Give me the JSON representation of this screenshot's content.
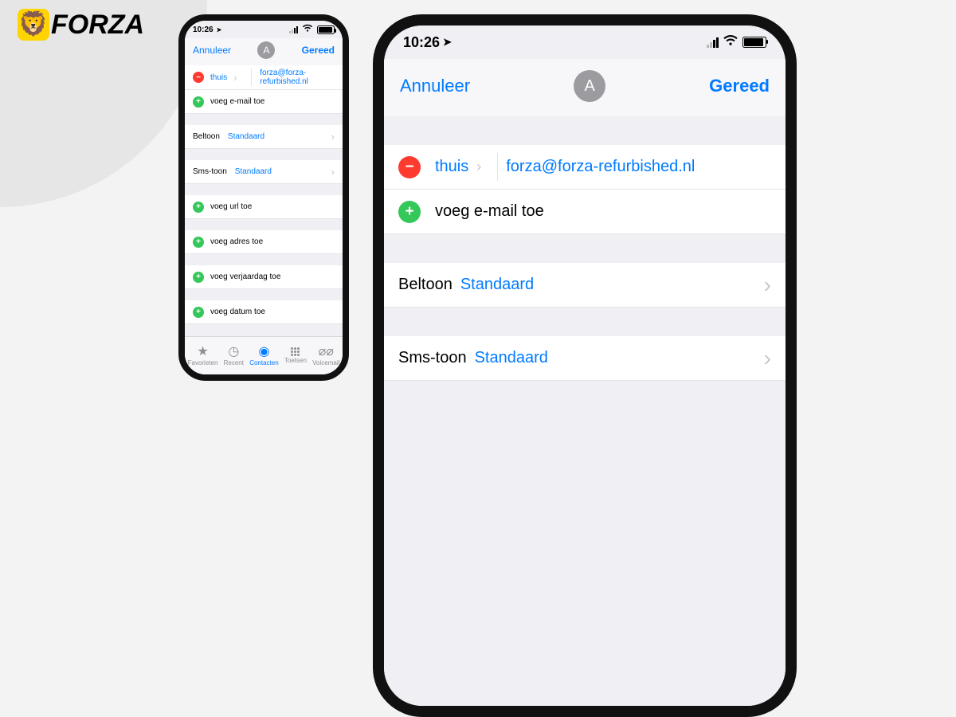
{
  "brand": {
    "word": "FORZA",
    "glyph": "🦁"
  },
  "status": {
    "time": "10:26",
    "location_glyph": "➤"
  },
  "nav": {
    "cancel": "Annuleer",
    "done": "Gereed",
    "avatar_letter": "A"
  },
  "email_row": {
    "label": "thuis",
    "value": "forza@forza-refurbished.nl"
  },
  "add_items": {
    "email": "voeg e-mail toe",
    "url": "voeg url toe",
    "address": "voeg adres toe",
    "birthday": "voeg verjaardag toe",
    "date": "voeg datum toe"
  },
  "settings": {
    "ringtone_key": "Beltoon",
    "ringtone_val": "Standaard",
    "texttone_key": "Sms-toon",
    "texttone_val": "Standaard"
  },
  "tabs": {
    "favorites": "Favorieten",
    "recent": "Recent",
    "contacts": "Contacten",
    "keypad": "Toetsen",
    "voicemail": "Voicemail"
  }
}
